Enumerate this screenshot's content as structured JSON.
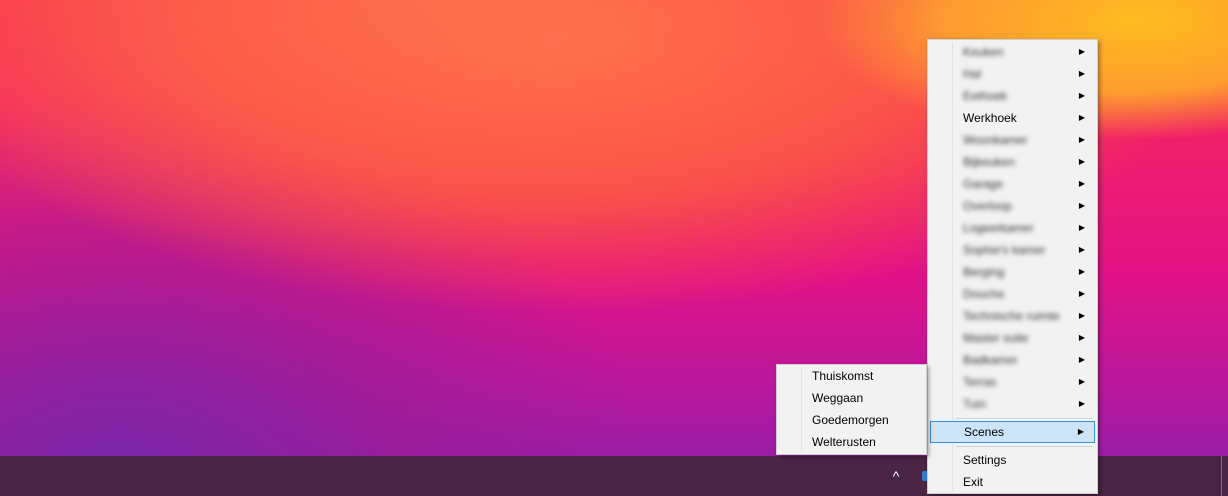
{
  "desktop": {
    "wallpaper_colors": [
      "#f7284f",
      "#e21286",
      "#9b1da6",
      "#ffbe1e"
    ]
  },
  "taskbar": {
    "background": "#4a2444",
    "tray_chevron": "^",
    "tray_icon": "app-tray-icon"
  },
  "main_menu": {
    "rooms": [
      {
        "label": "Keuken",
        "blurred": true,
        "has_submenu": true
      },
      {
        "label": "Hal",
        "blurred": true,
        "has_submenu": true
      },
      {
        "label": "Eethoek",
        "blurred": true,
        "has_submenu": true
      },
      {
        "label": "Werkhoek",
        "blurred": false,
        "has_submenu": true
      },
      {
        "label": "Woonkamer",
        "blurred": true,
        "has_submenu": true
      },
      {
        "label": "Bijkeuken",
        "blurred": true,
        "has_submenu": true
      },
      {
        "label": "Garage",
        "blurred": true,
        "has_submenu": true
      },
      {
        "label": "Overloop",
        "blurred": true,
        "has_submenu": true
      },
      {
        "label": "Logeerkamer",
        "blurred": true,
        "has_submenu": true
      },
      {
        "label": "Sophie's kamer",
        "blurred": true,
        "has_submenu": true
      },
      {
        "label": "Berging",
        "blurred": true,
        "has_submenu": true
      },
      {
        "label": "Douche",
        "blurred": true,
        "has_submenu": true
      },
      {
        "label": "Technische ruimte",
        "blurred": true,
        "has_submenu": true
      },
      {
        "label": "Master suite",
        "blurred": true,
        "has_submenu": true
      },
      {
        "label": "Badkamer",
        "blurred": true,
        "has_submenu": true
      },
      {
        "label": "Terras",
        "blurred": true,
        "has_submenu": true
      },
      {
        "label": "Tuin",
        "blurred": true,
        "has_submenu": true
      }
    ],
    "scenes_label": "Scenes",
    "settings_label": "Settings",
    "exit_label": "Exit",
    "highlight_color": "#cce4f7",
    "highlight_border": "#3d8fd6"
  },
  "scenes_submenu": {
    "items": [
      "Thuiskomst",
      "Weggaan",
      "Goedemorgen",
      "Welterusten"
    ]
  }
}
